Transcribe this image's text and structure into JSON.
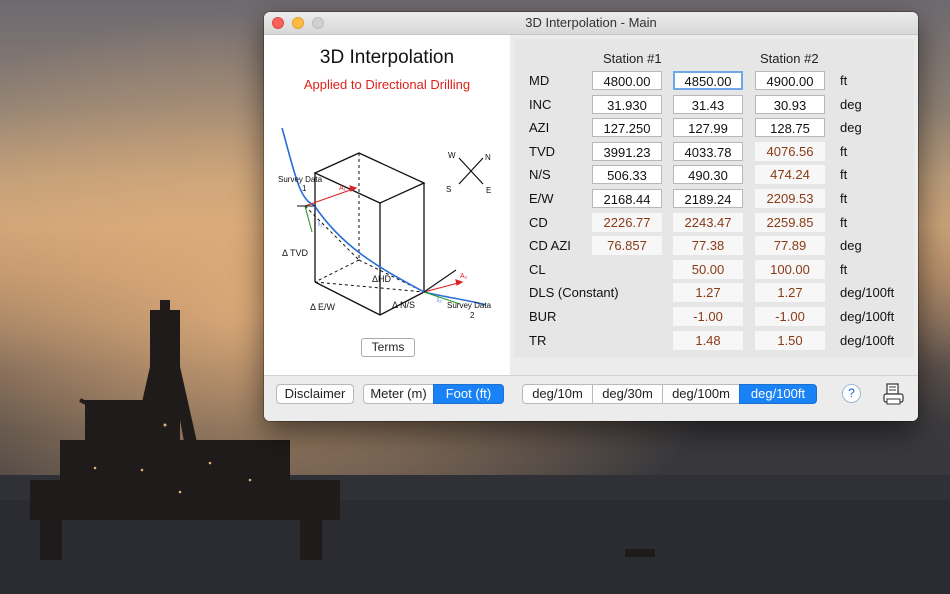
{
  "window": {
    "title": "3D Interpolation - Main"
  },
  "header": {
    "title": "3D Interpolation",
    "subtitle": "Applied to Directional Drilling"
  },
  "diagram": {
    "survey1_label": "Survey Data",
    "survey1_num": "1",
    "survey2_label": "Survey Data",
    "survey2_num": "2",
    "tvd": "Δ TVD",
    "hd": "ΔHD",
    "ew": "Δ E/W",
    "ns": "Δ N/S",
    "a1": "A₁",
    "a2": "A₂",
    "i1": "I₁",
    "i2": "I₂",
    "compass": {
      "w": "W",
      "n": "N",
      "s": "S",
      "e": "E"
    },
    "terms_label": "Terms"
  },
  "table": {
    "station1_header": "Station #1",
    "station2_header": "Station #2",
    "rows": [
      {
        "label": "MD",
        "s1": "4800.00",
        "mid": "4850.00",
        "s2": "4900.00",
        "unit": "ft"
      },
      {
        "label": "INC",
        "s1": "31.930",
        "mid": "31.43",
        "s2": "30.93",
        "unit": "deg"
      },
      {
        "label": "AZI",
        "s1": "127.250",
        "mid": "127.99",
        "s2": "128.75",
        "unit": "deg"
      },
      {
        "label": "TVD",
        "s1": "3991.23",
        "mid": "4033.78",
        "s2": "4076.56",
        "unit": "ft"
      },
      {
        "label": "N/S",
        "s1": "506.33",
        "mid": "490.30",
        "s2": "474.24",
        "unit": "ft"
      },
      {
        "label": "E/W",
        "s1": "2168.44",
        "mid": "2189.24",
        "s2": "2209.53",
        "unit": "ft"
      },
      {
        "label": "CD",
        "s1": "2226.77",
        "mid": "2243.47",
        "s2": "2259.85",
        "unit": "ft"
      },
      {
        "label": "CD AZI",
        "s1": "76.857",
        "mid": "77.38",
        "s2": "77.89",
        "unit": "deg"
      },
      {
        "label": "CL",
        "s1": "",
        "mid": "50.00",
        "s2": "100.00",
        "unit": "ft"
      },
      {
        "label": "DLS (Constant)",
        "s1": "",
        "mid": "1.27",
        "s2": "1.27",
        "unit": "deg/100ft"
      },
      {
        "label": "BUR",
        "s1": "",
        "mid": "-1.00",
        "s2": "-1.00",
        "unit": "deg/100ft"
      },
      {
        "label": "TR",
        "s1": "",
        "mid": "1.48",
        "s2": "1.50",
        "unit": "deg/100ft"
      }
    ]
  },
  "bottom": {
    "disclaimer": "Disclaimer",
    "units": [
      "Meter (m)",
      "Foot (ft)"
    ],
    "units_selected": "Foot (ft)",
    "rates": [
      "deg/10m",
      "deg/30m",
      "deg/100m",
      "deg/100ft"
    ],
    "rates_selected": "deg/100ft",
    "help": "?"
  },
  "colors": {
    "accent": "#1a82f7",
    "subtitle": "#e0201a",
    "calc_text": "#8a3a16"
  }
}
